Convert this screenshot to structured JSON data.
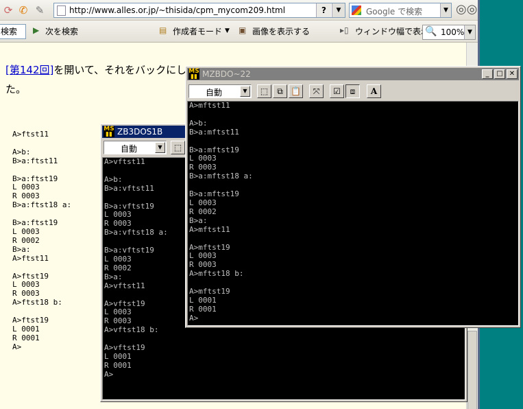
{
  "browser": {
    "url": "http://www.alles.or.jp/~thisida/cpm_mycom209.html",
    "search_placeholder": "Google で検索",
    "find_box_text": "検索",
    "find_next": "次を検索",
    "author_mode": "作成者モード",
    "show_images": "画像を表示する",
    "window_width": "ウィンドウ幅で表示",
    "zoom": "100%"
  },
  "page": {
    "link_text": "[第142回]",
    "line1_after_link": "を開いて、それをバックにして",
    "line2": "た。",
    "session_lines": [
      "A>ftst11",
      "",
      "A>b:",
      "B>a:ftst11",
      "",
      "B>a:ftst19",
      "L 0003",
      "R 0003",
      "B>a:ftst18 a:",
      "",
      "B>a:ftst19",
      "L 0003",
      "R 0002",
      "B>a:",
      "A>ftst11",
      "",
      "A>ftst19",
      "L 0003",
      "R 0003",
      "A>ftst18 b:",
      "",
      "A>ftst19",
      "L 0001",
      "R 0001",
      "A>"
    ]
  },
  "window_zb3": {
    "title": "ZB3DOS1B",
    "combo": "自動",
    "lines": [
      "A>vftst11",
      "",
      "A>b:",
      "B>a:vftst11",
      "",
      "B>a:vftst19",
      "L 0003",
      "R 0003",
      "B>a:vftst18 a:",
      "",
      "B>a:vftst19",
      "L 0003",
      "R 0002",
      "B>a:",
      "A>vftst11",
      "",
      "A>vftst19",
      "L 0003",
      "R 0003",
      "A>vftst18 b:",
      "",
      "A>vftst19",
      "L 0001",
      "R 0001",
      "A>"
    ]
  },
  "window_mzb": {
    "title": "MZBDO~22",
    "combo": "自動",
    "lines": [
      "A>mftst11",
      "",
      "A>b:",
      "B>a:mftst11",
      "",
      "B>a:mftst19",
      "L 0003",
      "R 0003",
      "B>a:mftst18 a:",
      "",
      "B>a:mftst19",
      "L 0003",
      "R 0002",
      "B>a:",
      "A>mftst11",
      "",
      "A>mftst19",
      "L 0003",
      "R 0003",
      "A>mftst18 b:",
      "",
      "A>mftst19",
      "L 0001",
      "R 0001",
      "A>"
    ]
  },
  "colors": {
    "desktop": "#008080",
    "page_bg": "#fffde8",
    "title_active": "#0a246a",
    "title_inactive": "#808080",
    "terminal_bg": "#000000",
    "terminal_fg": "#c0c0c0"
  }
}
